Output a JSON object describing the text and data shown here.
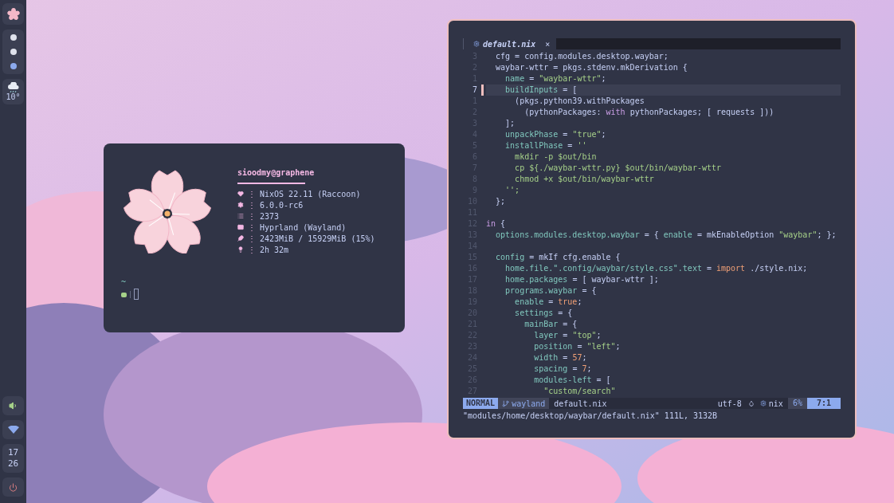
{
  "bar": {
    "workspaces": [
      {
        "selected": false
      },
      {
        "selected": false
      },
      {
        "selected": true
      }
    ],
    "weather": {
      "temperature": "10°"
    },
    "clock": {
      "hour": "17",
      "minute": "26"
    }
  },
  "fetch": {
    "user": "sioodmy@graphene",
    "rows": [
      {
        "kind": "heart",
        "sep": "⋮",
        "value": "NixOS 22.11 (Raccoon)"
      },
      {
        "kind": "gear",
        "sep": "⋮",
        "value": "6.0.0-rc6"
      },
      {
        "kind": "list",
        "sep": "⋮",
        "value": "2373"
      },
      {
        "kind": "windows",
        "sep": "⋮",
        "value": "Hyprland (Wayland)"
      },
      {
        "kind": "feather",
        "sep": "⋮",
        "value": "2423MiB / 15929MiB (15%)"
      },
      {
        "kind": "bulb",
        "sep": "⋮",
        "value": "2h 32m"
      }
    ],
    "prompt": {
      "dir": "~"
    }
  },
  "editor": {
    "tab": {
      "title": "default.nix",
      "close": "×"
    },
    "lines": [
      {
        "number": "3",
        "current": false,
        "segments": [
          {
            "kind": "plain",
            "text": "  cfg = config.modules.desktop.waybar;"
          }
        ]
      },
      {
        "number": "2",
        "current": false,
        "segments": [
          {
            "kind": "plain",
            "text": "  waybar-wttr = pkgs.stdenv.mkDerivation {"
          }
        ]
      },
      {
        "number": "1",
        "current": false,
        "segments": [
          {
            "kind": "attr",
            "text": "    name"
          },
          {
            "kind": "plain",
            "text": " = "
          },
          {
            "kind": "string",
            "text": "\"waybar-wttr\""
          },
          {
            "kind": "plain",
            "text": ";"
          }
        ]
      },
      {
        "number": "7",
        "current": true,
        "segments": [
          {
            "kind": "attr",
            "text": "    buildInputs"
          },
          {
            "kind": "plain",
            "text": " = ["
          }
        ]
      },
      {
        "number": "1",
        "current": false,
        "segments": [
          {
            "kind": "plain",
            "text": "      (pkgs.python39.withPackages"
          }
        ]
      },
      {
        "number": "2",
        "current": false,
        "segments": [
          {
            "kind": "plain",
            "text": "        (pythonPackages: "
          },
          {
            "kind": "keyword",
            "text": "with"
          },
          {
            "kind": "plain",
            "text": " pythonPackages; [ requests ]))"
          }
        ]
      },
      {
        "number": "3",
        "current": false,
        "segments": [
          {
            "kind": "plain",
            "text": "    ];"
          }
        ]
      },
      {
        "number": "4",
        "current": false,
        "segments": [
          {
            "kind": "attr",
            "text": "    unpackPhase"
          },
          {
            "kind": "plain",
            "text": " = "
          },
          {
            "kind": "string",
            "text": "\"true\""
          },
          {
            "kind": "plain",
            "text": ";"
          }
        ]
      },
      {
        "number": "5",
        "current": false,
        "segments": [
          {
            "kind": "attr",
            "text": "    installPhase"
          },
          {
            "kind": "plain",
            "text": " = "
          },
          {
            "kind": "string",
            "text": "''"
          }
        ]
      },
      {
        "number": "6",
        "current": false,
        "segments": [
          {
            "kind": "string",
            "text": "      mkdir -p $out/bin"
          }
        ]
      },
      {
        "number": "7",
        "current": false,
        "segments": [
          {
            "kind": "string",
            "text": "      cp ${./waybar-wttr.py} $out/bin/waybar-wttr"
          }
        ]
      },
      {
        "number": "8",
        "current": false,
        "segments": [
          {
            "kind": "string",
            "text": "      chmod +x $out/bin/waybar-wttr"
          }
        ]
      },
      {
        "number": "9",
        "current": false,
        "segments": [
          {
            "kind": "string",
            "text": "    '';"
          }
        ]
      },
      {
        "number": "10",
        "current": false,
        "segments": [
          {
            "kind": "plain",
            "text": "  };"
          }
        ]
      },
      {
        "number": "11",
        "current": false
      },
      {
        "number": "12",
        "current": false,
        "segments": [
          {
            "kind": "keyword",
            "text": "in"
          },
          {
            "kind": "plain",
            "text": " {"
          }
        ]
      },
      {
        "number": "13",
        "current": false,
        "segments": [
          {
            "kind": "attr",
            "text": "  options.modules.desktop.waybar"
          },
          {
            "kind": "plain",
            "text": " = { "
          },
          {
            "kind": "attr",
            "text": "enable"
          },
          {
            "kind": "plain",
            "text": " = mkEnableOption "
          },
          {
            "kind": "string",
            "text": "\"waybar\""
          },
          {
            "kind": "plain",
            "text": "; };"
          }
        ]
      },
      {
        "number": "14",
        "current": false
      },
      {
        "number": "15",
        "current": false,
        "segments": [
          {
            "kind": "attr",
            "text": "  config"
          },
          {
            "kind": "plain",
            "text": " = mkIf cfg.enable {"
          }
        ]
      },
      {
        "number": "16",
        "current": false,
        "segments": [
          {
            "kind": "attr",
            "text": "    home.file.\".config/waybar/style.css\".text"
          },
          {
            "kind": "plain",
            "text": " = "
          },
          {
            "kind": "builtin",
            "text": "import"
          },
          {
            "kind": "plain",
            "text": " ./style.nix;"
          }
        ]
      },
      {
        "number": "17",
        "current": false,
        "segments": [
          {
            "kind": "attr",
            "text": "    home.packages"
          },
          {
            "kind": "plain",
            "text": " = [ waybar-wttr ];"
          }
        ]
      },
      {
        "number": "18",
        "current": false,
        "segments": [
          {
            "kind": "attr",
            "text": "    programs.waybar"
          },
          {
            "kind": "plain",
            "text": " = {"
          }
        ]
      },
      {
        "number": "19",
        "current": false,
        "segments": [
          {
            "kind": "attr",
            "text": "      enable"
          },
          {
            "kind": "plain",
            "text": " = "
          },
          {
            "kind": "builtin",
            "text": "true"
          },
          {
            "kind": "plain",
            "text": ";"
          }
        ]
      },
      {
        "number": "20",
        "current": false,
        "segments": [
          {
            "kind": "attr",
            "text": "      settings"
          },
          {
            "kind": "plain",
            "text": " = {"
          }
        ]
      },
      {
        "number": "21",
        "current": false,
        "segments": [
          {
            "kind": "attr",
            "text": "        mainBar"
          },
          {
            "kind": "plain",
            "text": " = {"
          }
        ]
      },
      {
        "number": "22",
        "current": false,
        "segments": [
          {
            "kind": "attr",
            "text": "          layer"
          },
          {
            "kind": "plain",
            "text": " = "
          },
          {
            "kind": "string",
            "text": "\"top\""
          },
          {
            "kind": "plain",
            "text": ";"
          }
        ]
      },
      {
        "number": "23",
        "current": false,
        "segments": [
          {
            "kind": "attr",
            "text": "          position"
          },
          {
            "kind": "plain",
            "text": " = "
          },
          {
            "kind": "string",
            "text": "\"left\""
          },
          {
            "kind": "plain",
            "text": ";"
          }
        ]
      },
      {
        "number": "24",
        "current": false,
        "segments": [
          {
            "kind": "attr",
            "text": "          width"
          },
          {
            "kind": "plain",
            "text": " = "
          },
          {
            "kind": "builtin",
            "text": "57"
          },
          {
            "kind": "plain",
            "text": ";"
          }
        ]
      },
      {
        "number": "25",
        "current": false,
        "segments": [
          {
            "kind": "attr",
            "text": "          spacing"
          },
          {
            "kind": "plain",
            "text": " = "
          },
          {
            "kind": "builtin",
            "text": "7"
          },
          {
            "kind": "plain",
            "text": ";"
          }
        ]
      },
      {
        "number": "26",
        "current": false,
        "segments": [
          {
            "kind": "attr",
            "text": "          modules-left"
          },
          {
            "kind": "plain",
            "text": " = ["
          }
        ]
      },
      {
        "number": "27",
        "current": false,
        "segments": [
          {
            "kind": "string",
            "text": "            \"custom/search\""
          }
        ]
      }
    ],
    "status": {
      "mode": "NORMAL",
      "branch": "wayland",
      "file": "default.nix",
      "encoding": "utf-8",
      "filetype": "nix",
      "percent": "6%",
      "position": "7:1"
    },
    "message": "\"modules/home/desktop/waybar/default.nix\" 111L, 3132B"
  }
}
